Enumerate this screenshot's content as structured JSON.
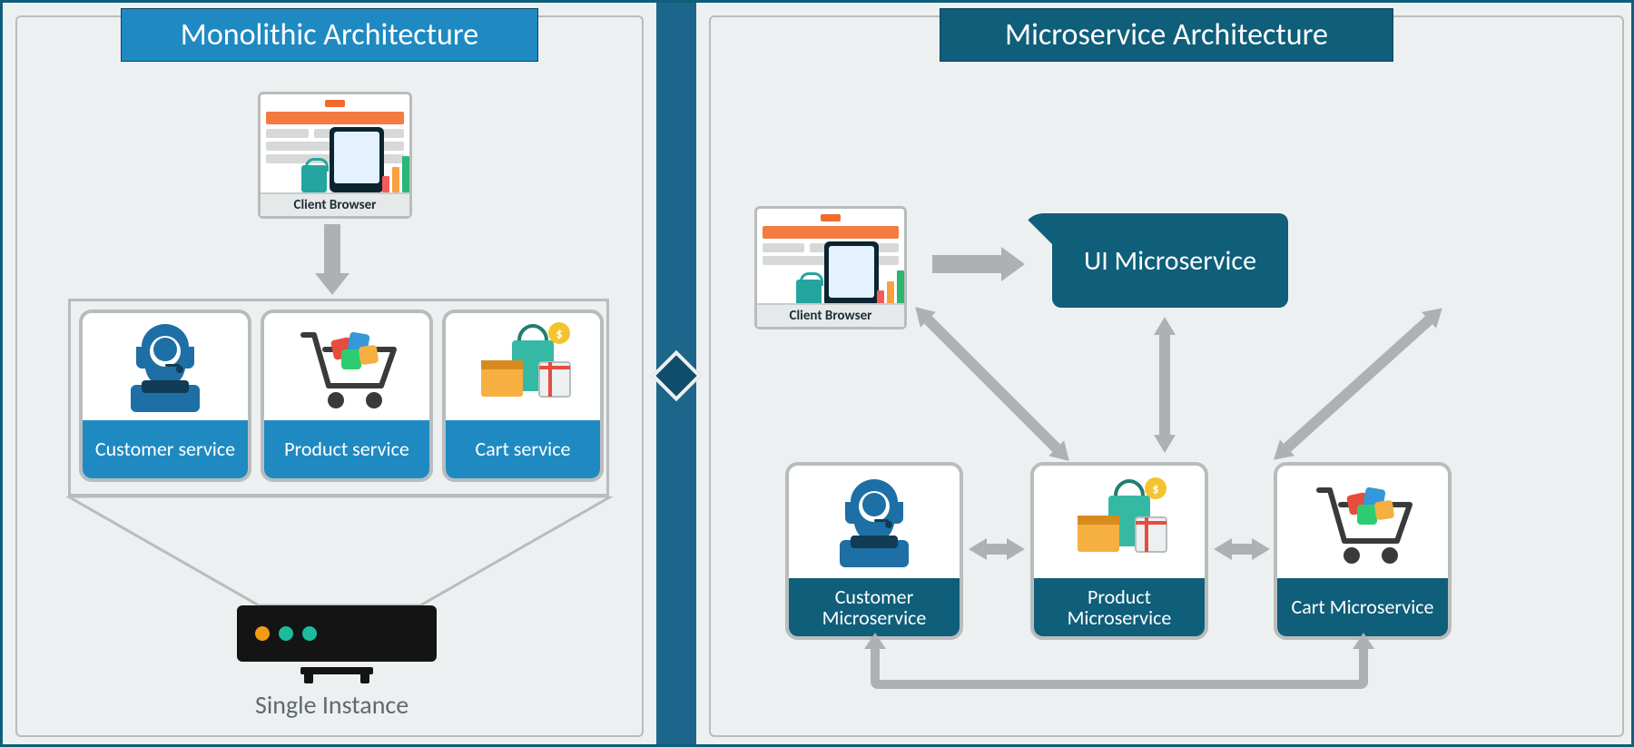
{
  "left": {
    "title": "Monolithic Architecture",
    "client_browser": "Client Browser",
    "services": {
      "customer": "Customer service",
      "product": "Product service",
      "cart": "Cart service"
    },
    "single_instance": "Single Instance"
  },
  "right": {
    "title": "Microservice Architecture",
    "client_browser": "Client Browser",
    "ui_microservice": "UI Microservice",
    "services": {
      "customer": "Customer Microservice",
      "product": "Product Microservice",
      "cart": "Cart Microservice"
    }
  },
  "colors": {
    "light_blue": "#1f8ac2",
    "dark_blue": "#0f5e7a",
    "accent_orange": "#f47b3f",
    "gray": "#aeb1b2"
  }
}
